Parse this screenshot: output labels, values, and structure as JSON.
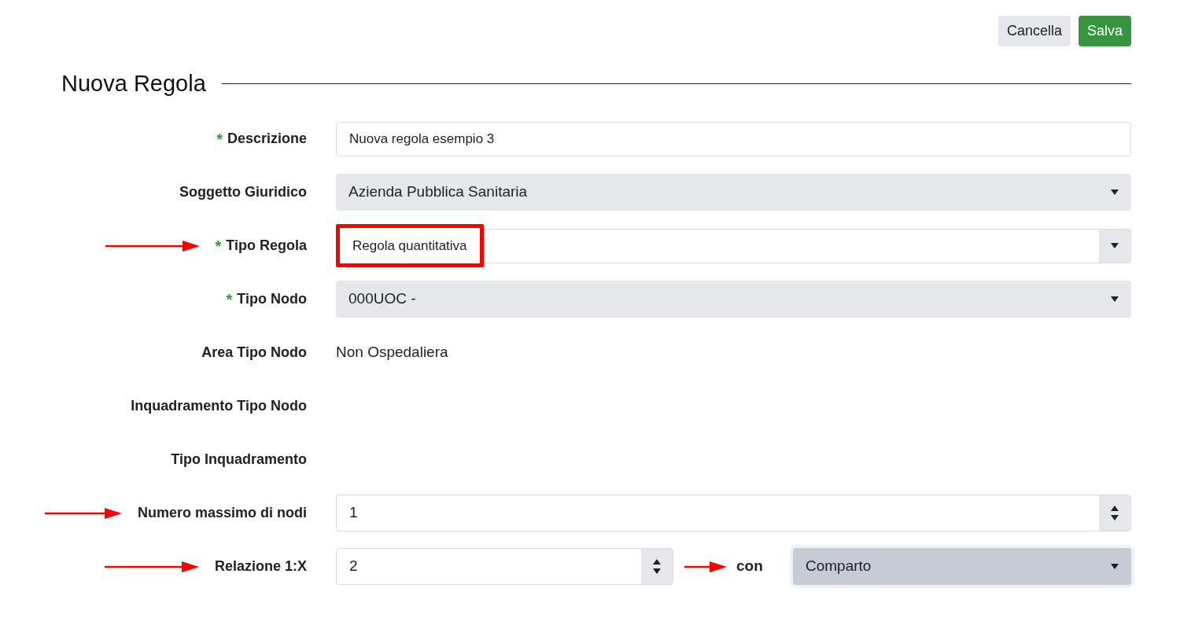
{
  "buttons": [
    {
      "label": "Cancella",
      "kind": "secondary"
    },
    {
      "label": "Salva",
      "kind": "primary"
    }
  ],
  "title": "Nuova Regola",
  "rows": [
    {
      "label": "Descrizione",
      "required_mark": "*",
      "arrow": false,
      "kind": "text",
      "value": "Nuova regola esempio 3"
    },
    {
      "label": "Soggetto Giuridico",
      "arrow": false,
      "kind": "select",
      "value": "Azienda Pubblica Sanitaria"
    },
    {
      "label": "Tipo Regola",
      "required_mark": "*",
      "arrow": true,
      "kind": "combo",
      "value": "Regola quantitativa",
      "highlighted": true
    },
    {
      "label": "Tipo Nodo",
      "required_mark": "*",
      "arrow": false,
      "kind": "select",
      "value": "000UOC -"
    },
    {
      "label": "Area Tipo Nodo",
      "arrow": false,
      "kind": "static",
      "value": "Non Ospedaliera"
    },
    {
      "label": "Inquadramento Tipo Nodo",
      "arrow": false,
      "kind": "static"
    },
    {
      "label": "Tipo Inquadramento",
      "arrow": false,
      "kind": "static"
    },
    {
      "label": "Numero massimo di nodi",
      "arrow": true,
      "kind": "number",
      "value": "1"
    },
    {
      "label": "Relazione 1:X",
      "arrow": true,
      "kind": "relation",
      "value": "2",
      "connector": "con",
      "connector_arrow": true,
      "related": {
        "value": "Comparto",
        "focused": true
      }
    }
  ]
}
